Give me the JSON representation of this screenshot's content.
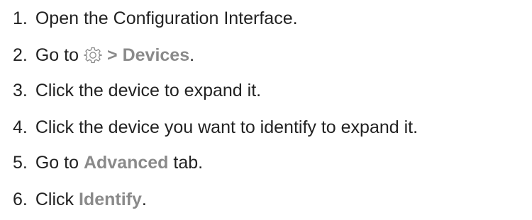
{
  "steps": [
    {
      "number": "1.",
      "text": "Open the Configuration Interface."
    },
    {
      "number": "2.",
      "before": "Go to",
      "icon": "gear-icon",
      "separator": ">",
      "target": "Devices",
      "after": "."
    },
    {
      "number": "3.",
      "text": "Click the device to expand it."
    },
    {
      "number": "4.",
      "text": "Click the device you want to identify to expand it."
    },
    {
      "number": "5.",
      "before": "Go to",
      "target": "Advanced",
      "after": "tab."
    },
    {
      "number": "6.",
      "before": "Click",
      "target": "Identify",
      "after": "."
    }
  ],
  "colors": {
    "text": "#222222",
    "ui_reference": "#8a8a8a"
  }
}
